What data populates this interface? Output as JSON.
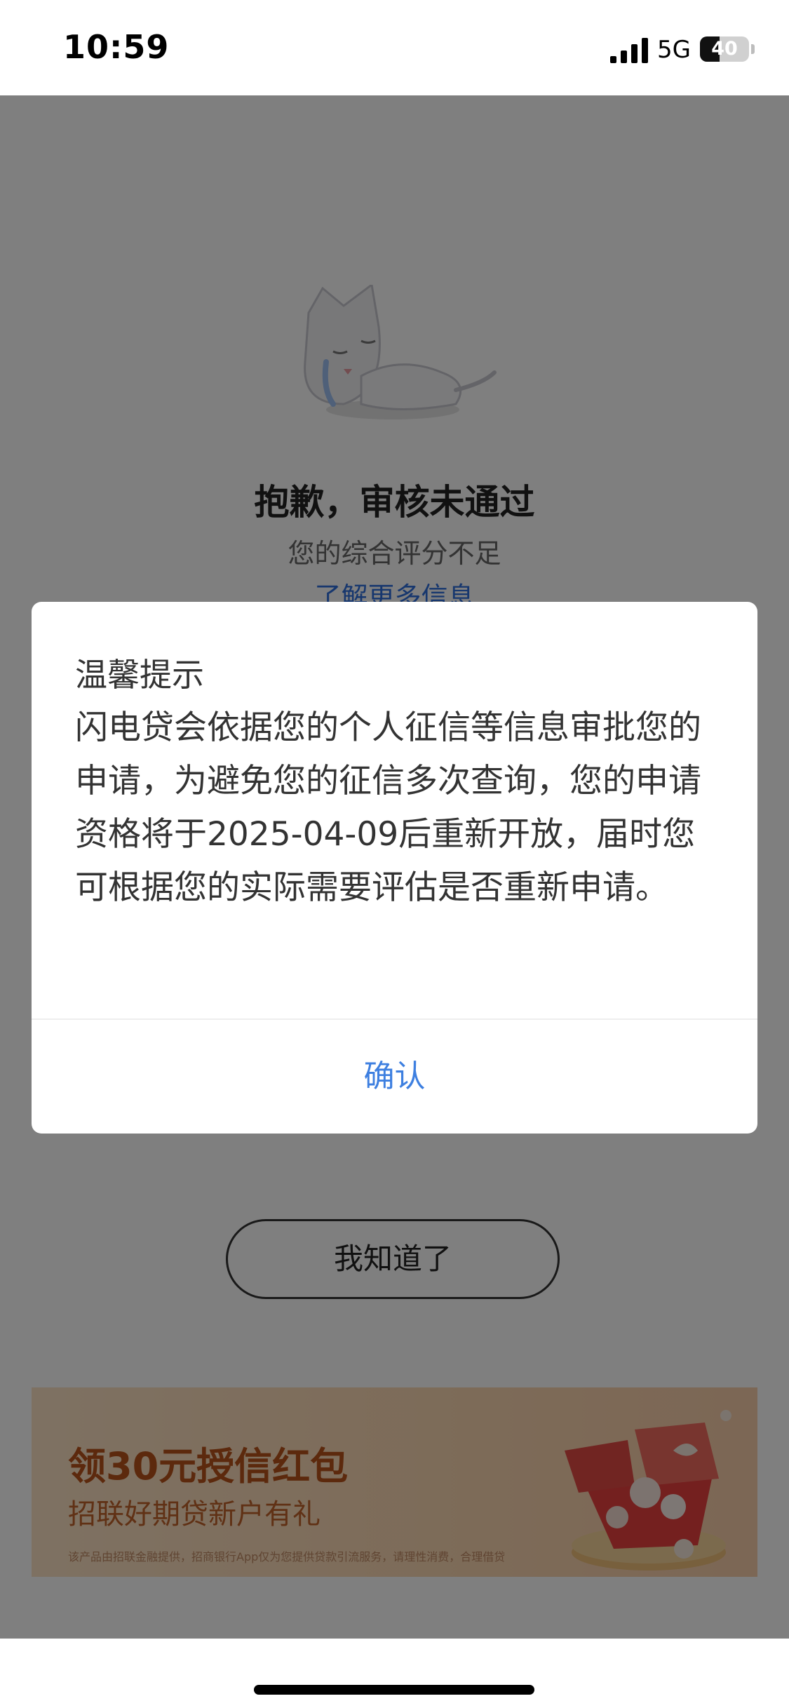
{
  "status_bar": {
    "time": "10:59",
    "network": "5G",
    "battery": 40,
    "battery_text": "40"
  },
  "page": {
    "result_title": "抱歉，审核未通过",
    "result_subtitle": "您的综合评分不足",
    "more_info_link": "了解更多信息",
    "acknowledge_button": "我知道了",
    "banner": {
      "title": "领30元授信红包",
      "subtitle": "招联好期贷新户有礼",
      "note": "该产品由招联金融提供，招商银行App仅为您提供贷款引流服务，请理性消费，合理借贷"
    }
  },
  "dialog": {
    "title": "温馨提示",
    "body": "闪电贷会依据您的个人征信等信息审批您的申请，为避免您的征信多次查询，您的申请资格将于2025-04-09后重新开放，届时您可根据您的实际需要评估是否重新申请。",
    "confirm_label": "确认"
  },
  "colors": {
    "link": "#2f6fdc",
    "confirm": "#3d7fe0",
    "banner_text": "#b8531b",
    "overlay": "rgba(0,0,0,0.5)"
  },
  "icons": [
    "signal-icon",
    "battery-icon",
    "mascot-illustration",
    "gift-box-illustration"
  ]
}
